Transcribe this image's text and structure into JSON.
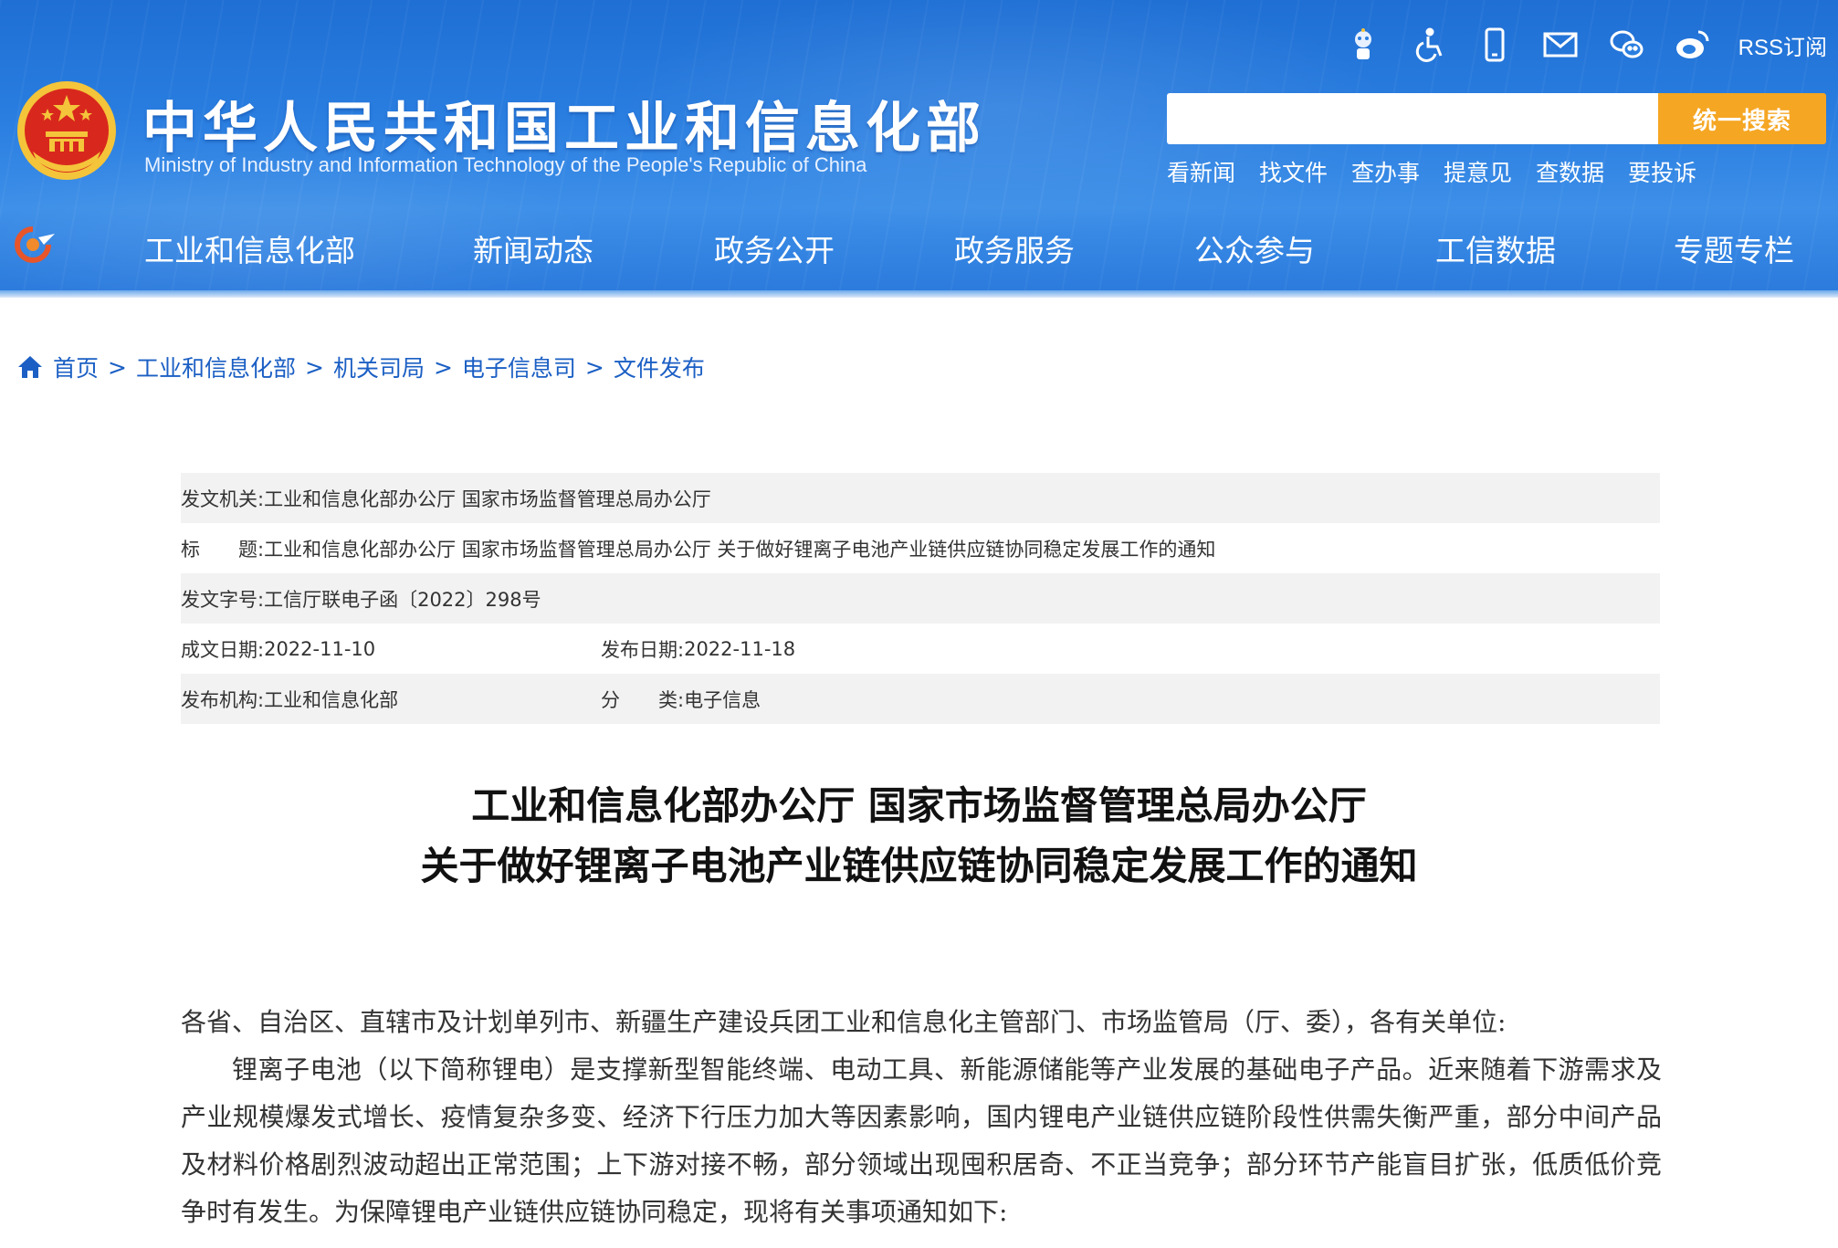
{
  "header": {
    "title": "中华人民共和国工业和信息化部",
    "subtitle": "Ministry of Industry and Information Technology of the People's Republic of China",
    "tools": [
      {
        "icon": "robot-assistant-icon"
      },
      {
        "icon": "accessibility-icon"
      },
      {
        "icon": "mobile-icon"
      },
      {
        "icon": "mail-icon"
      },
      {
        "icon": "wechat-icon"
      },
      {
        "icon": "weibo-icon"
      }
    ],
    "rss_label": "RSS订阅",
    "search": {
      "placeholder": "",
      "button_label": "统一搜索"
    },
    "quick_links": [
      "看新闻",
      "找文件",
      "查办事",
      "提意见",
      "查数据",
      "要投诉"
    ],
    "nav": [
      "工业和信息化部",
      "新闻动态",
      "政务公开",
      "政务服务",
      "公众参与",
      "工信数据",
      "专题专栏"
    ],
    "colors": {
      "primary": "#2a7ee0",
      "search_button": "#f5a623",
      "emblem_red": "#d8281d",
      "emblem_gold": "#f4c43a"
    }
  },
  "breadcrumb": {
    "icon": "home-icon",
    "items": [
      "首页",
      "工业和信息化部",
      "机关司局",
      "电子信息司",
      "文件发布"
    ],
    "separator": ">",
    "link_color": "#1b5fc4"
  },
  "meta": {
    "issuer_label": "发文机关:",
    "issuer_value": "工业和信息化部办公厅 国家市场监督管理总局办公厅",
    "title_label": "标　　题:",
    "title_value": "工业和信息化部办公厅 国家市场监督管理总局办公厅 关于做好锂离子电池产业链供应链协同稳定发展工作的通知",
    "doc_no_label": "发文字号:",
    "doc_no_value": "工信厅联电子函〔2022〕298号",
    "written_label": "成文日期:",
    "written_value": "2022-11-10",
    "published_label": "发布日期:",
    "published_value": "2022-11-18",
    "agency_label": "发布机构:",
    "agency_value": "工业和信息化部",
    "category_label": "分　　类:",
    "category_value": "电子信息"
  },
  "document": {
    "title_line1": "工业和信息化部办公厅 国家市场监督管理总局办公厅",
    "title_line2": "关于做好锂离子电池产业链供应链协同稳定发展工作的通知",
    "salutation": "各省、自治区、直辖市及计划单列市、新疆生产建设兵团工业和信息化主管部门、市场监管局（厅、委），各有关单位:",
    "paragraph1": "锂离子电池（以下简称锂电）是支撑新型智能终端、电动工具、新能源储能等产业发展的基础电子产品。近来随着下游需求及产业规模爆发式增长、疫情复杂多变、经济下行压力加大等因素影响，国内锂电产业链供应链阶段性供需失衡严重，部分中间产品及材料价格剧烈波动超出正常范围；上下游对接不畅，部分领域出现囤积居奇、不正当竞争；部分环节产能盲目扩张，低质低价竞争时有发生。为保障锂电产业链供应链协同稳定，现将有关事项通知如下:"
  }
}
